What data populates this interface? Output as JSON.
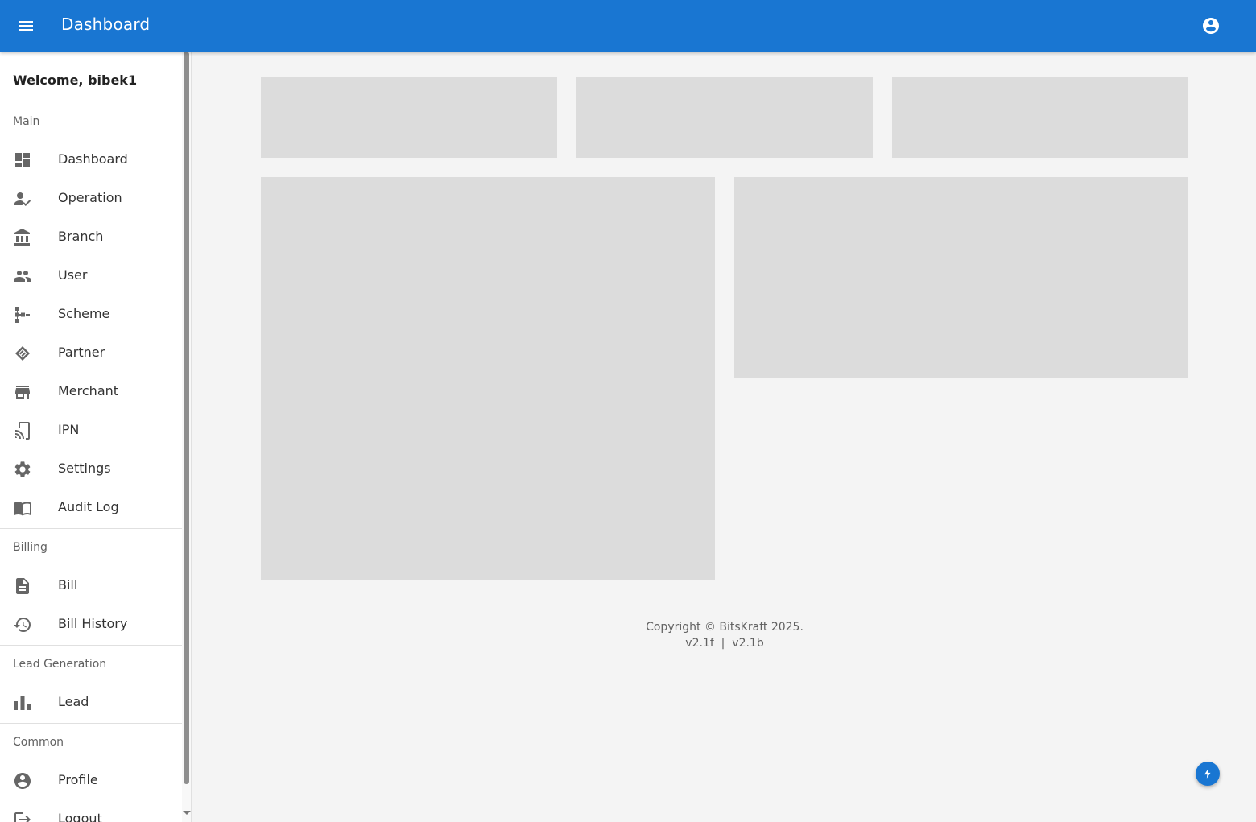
{
  "appbar": {
    "title": "Dashboard",
    "menu_icon": "hamburger-menu-icon",
    "account_icon": "account-circle-icon",
    "background": "#1976d2"
  },
  "sidebar": {
    "welcome": "Welcome, bibek1",
    "sections": [
      {
        "label": "Main",
        "items": [
          {
            "label": "Dashboard",
            "icon": "dashboard-icon"
          },
          {
            "label": "Operation",
            "icon": "person-check-icon"
          },
          {
            "label": "Branch",
            "icon": "bank-icon"
          },
          {
            "label": "User",
            "icon": "people-icon"
          },
          {
            "label": "Scheme",
            "icon": "account-tree-icon"
          },
          {
            "label": "Partner",
            "icon": "handshake-icon"
          },
          {
            "label": "Merchant",
            "icon": "store-icon"
          },
          {
            "label": "IPN",
            "icon": "cast-icon"
          },
          {
            "label": "Settings",
            "icon": "gear-icon"
          },
          {
            "label": "Audit Log",
            "icon": "book-open-icon"
          }
        ]
      },
      {
        "label": "Billing",
        "items": [
          {
            "label": "Bill",
            "icon": "document-icon"
          },
          {
            "label": "Bill History",
            "icon": "history-icon"
          }
        ]
      },
      {
        "label": "Lead Generation",
        "items": [
          {
            "label": "Lead",
            "icon": "bar-chart-icon"
          }
        ]
      },
      {
        "label": "Common",
        "items": [
          {
            "label": "Profile",
            "icon": "account-circle-icon"
          },
          {
            "label": "Logout",
            "icon": "logout-icon"
          }
        ]
      }
    ]
  },
  "footer": {
    "copyright": "Copyright © BitsKraft 2025.",
    "version": "v2.1f  |  v2.1b"
  },
  "fab": {
    "icon": "lightning-bolt-icon"
  }
}
